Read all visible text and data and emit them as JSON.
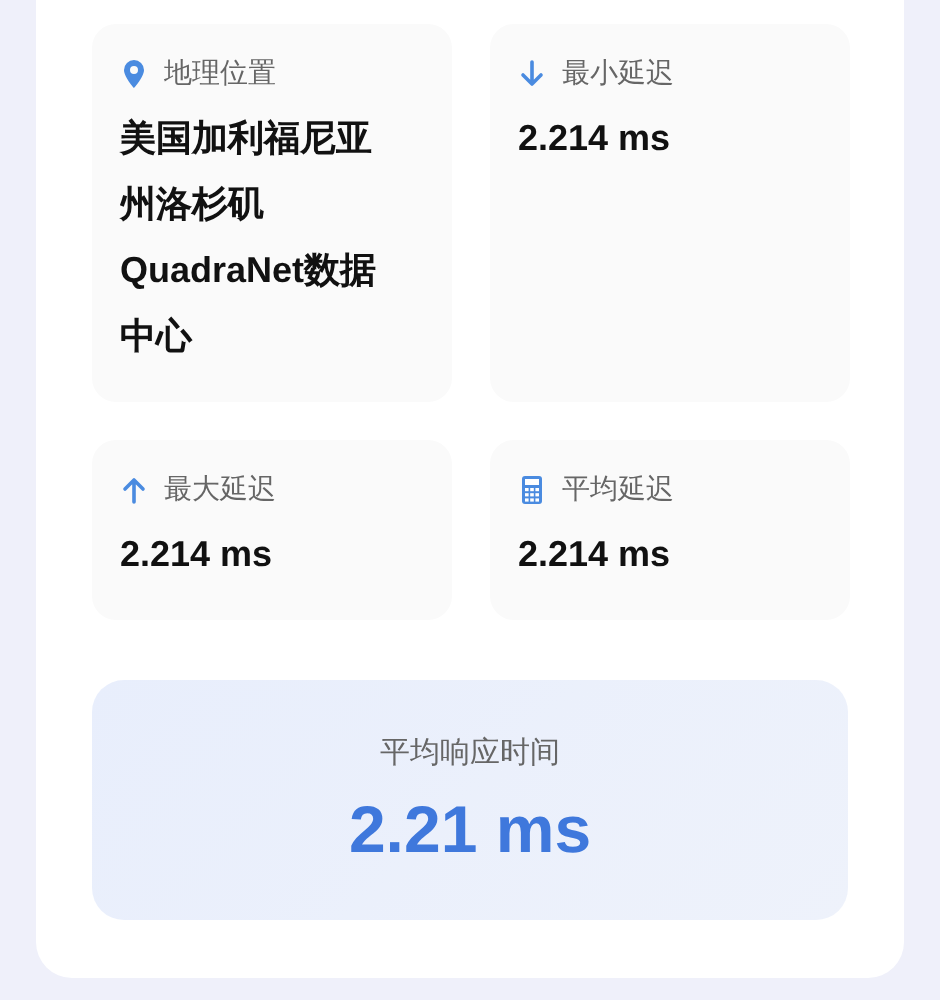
{
  "stats": [
    {
      "kind": "pin",
      "label": "地理位置",
      "value": "美国加利福尼亚州洛杉矶QuadraNet数据中心"
    },
    {
      "kind": "down",
      "label": "最小延迟",
      "value": "2.214 ms"
    },
    {
      "kind": "up",
      "label": "最大延迟",
      "value": "2.214 ms"
    },
    {
      "kind": "calculator",
      "label": "平均延迟",
      "value": "2.214 ms"
    }
  ],
  "summary": {
    "label": "平均响应时间",
    "value": "2.21 ms"
  }
}
